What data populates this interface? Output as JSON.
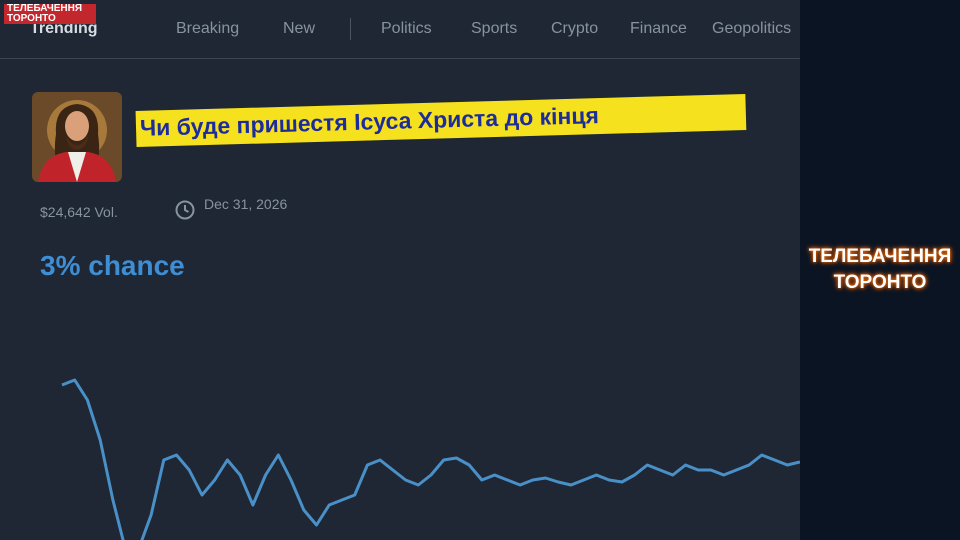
{
  "logo": {
    "line1": "ТЕЛЕБАЧЕННЯ",
    "line2": "ТОРОНТО"
  },
  "nav": {
    "items": [
      "Trending",
      "Breaking",
      "New",
      "Politics",
      "Sports",
      "Crypto",
      "Finance",
      "Geopolitics"
    ]
  },
  "market": {
    "title": "Чи буде пришестя Ісуса Христа до кінця",
    "volume": "$24,642 Vol.",
    "end_date": "Dec 31, 2026",
    "chance": "3% chance"
  },
  "chart_data": {
    "type": "line",
    "title": "",
    "xlabel": "",
    "ylabel": "",
    "y_unit": "%",
    "ylim": [
      0,
      20
    ],
    "grid": false,
    "series": [
      {
        "color": "#4a90c8",
        "values": [
          16.5,
          17.0,
          15.0,
          11.0,
          5.0,
          0.0,
          0.0,
          3.5,
          9.0,
          9.5,
          8.0,
          5.5,
          7.0,
          9.0,
          7.5,
          4.5,
          7.5,
          9.5,
          7.0,
          4.0,
          2.5,
          4.5,
          5.0,
          5.5,
          8.5,
          9.0,
          8.0,
          7.0,
          6.5,
          7.5,
          9.0,
          9.2,
          8.5,
          7.0,
          7.5,
          7.0,
          6.5,
          7.0,
          7.2,
          6.8,
          6.5,
          7.0,
          7.5,
          7.0,
          6.8,
          7.5,
          8.5,
          8.0,
          7.5,
          8.5,
          8.0,
          8.0,
          7.5,
          8.0,
          8.5,
          9.5,
          9.0,
          8.5,
          8.8
        ]
      }
    ]
  },
  "overlay": {
    "channel": "ТЕЛЕБАЧЕННЯ ТОРОНТО"
  },
  "colors": {
    "background": "#1e2733",
    "accent": "#3f8ed4",
    "highlight": "#f6e11e",
    "side_panel": "#0b1422"
  }
}
